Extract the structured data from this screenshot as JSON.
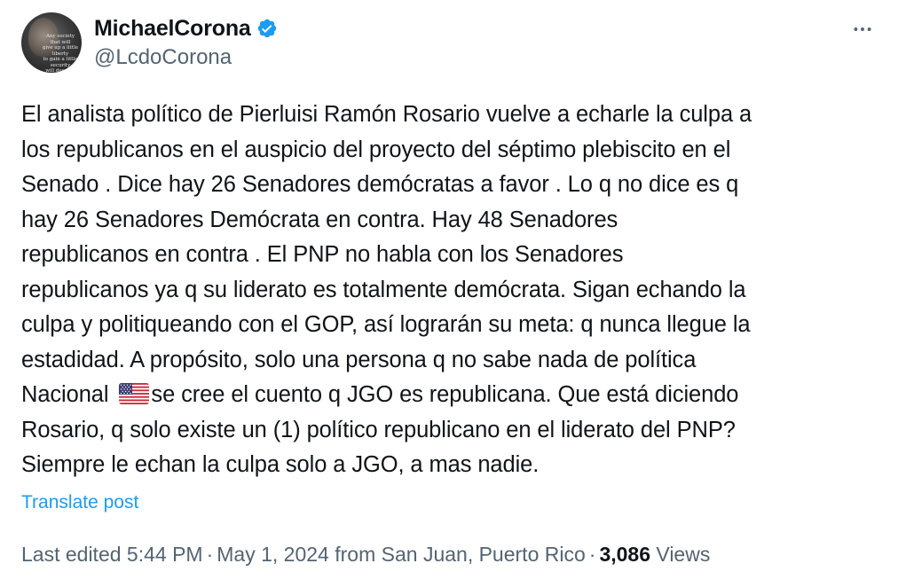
{
  "author": {
    "display_name": "MichaelCorona",
    "handle": "@LcdoCorona",
    "verified": true,
    "verified_color": "#1d9bf0",
    "avatar_quote": "Any society that will\ngive up a little liberty\nto gain a little security\nwill deserve neither\nand lose both."
  },
  "menu": {
    "more_icon": "more-horizontal-icon"
  },
  "post": {
    "lines": [
      "El analista político de Pierluisi Ramón Rosario vuelve a echarle la culpa a",
      "los republicanos en el auspicio del proyecto del séptimo plebiscito en el",
      "Senado . Dice hay 26 Senadores demócratas a favor . Lo q no dice es q",
      "hay 26 Senadores Demócrata en contra. Hay 48 Senadores",
      "republicanos en contra . El PNP no habla con los Senadores",
      "republicanos ya q su liderato es totalmente demócrata. Sigan echando la",
      "culpa y politiqueando con el GOP, así lograrán su meta: q nunca llegue la",
      "estadidad. A propósito, solo una persona q no sabe nada de política"
    ],
    "line_flag_before": "Nacional ",
    "flag_icon": "us-flag-icon",
    "line_flag_after": "se cree el cuento q JGO es republicana. Que está diciendo",
    "lines_end": [
      "Rosario, q solo existe un (1) político republicano en el liderato del PNP?",
      "Siempre le echan la culpa solo  a JGO, a mas nadie."
    ],
    "translate_label": "Translate post"
  },
  "meta": {
    "edited_time": "Last edited 5:44 PM",
    "separator": "·",
    "date": "May 1, 2024",
    "location": "from San Juan, Puerto Rico",
    "views_count": "3,086",
    "views_label": "Views"
  },
  "colors": {
    "text": "#0f1419",
    "secondary": "#536471",
    "link": "#1d9bf0"
  }
}
